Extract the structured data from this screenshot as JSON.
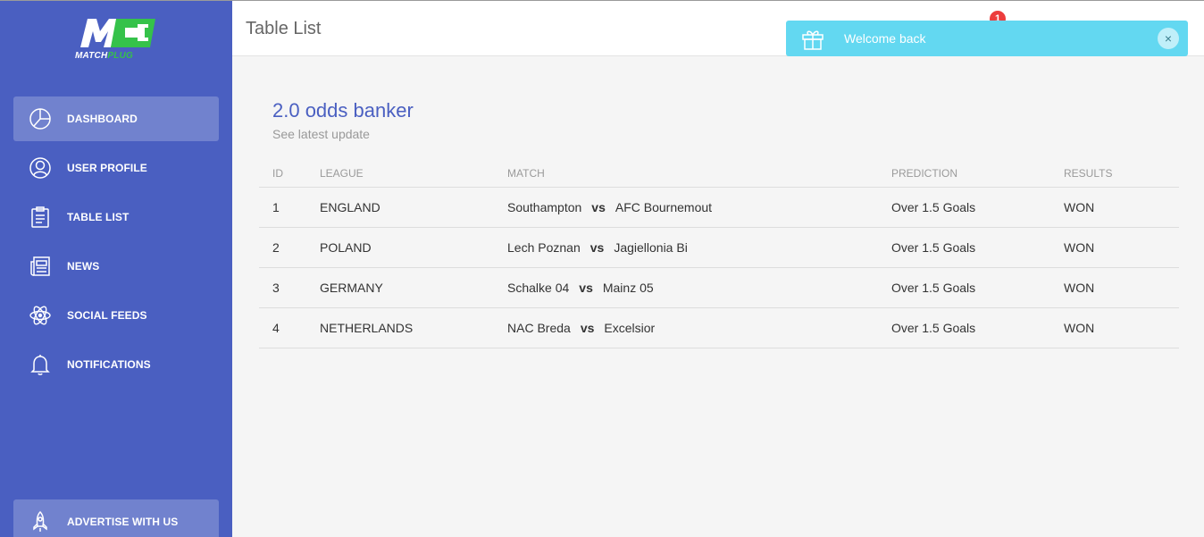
{
  "brand": {
    "mark": "M",
    "name_part1": "MATCH",
    "name_part2": "PLUG"
  },
  "sidebar": {
    "items": [
      {
        "label": "DASHBOARD",
        "icon": "pie-chart-icon",
        "active": true
      },
      {
        "label": "USER PROFILE",
        "icon": "user-icon",
        "active": false
      },
      {
        "label": "TABLE LIST",
        "icon": "clipboard-icon",
        "active": false
      },
      {
        "label": "NEWS",
        "icon": "newspaper-icon",
        "active": false
      },
      {
        "label": "SOCIAL FEEDS",
        "icon": "atom-icon",
        "active": false
      },
      {
        "label": "NOTIFICATIONS",
        "icon": "bell-icon",
        "active": false
      }
    ],
    "footer_item": {
      "label": "ADVERTISE WITH US",
      "icon": "rocket-icon"
    }
  },
  "header": {
    "title": "Table List",
    "notification_count": "1"
  },
  "toast": {
    "message": "Welcome back",
    "icon": "gift-icon",
    "close": "×"
  },
  "card": {
    "title": "2.0 odds banker",
    "subtitle": "See latest update"
  },
  "table": {
    "columns": [
      "ID",
      "LEAGUE",
      "MATCH",
      "PREDICTION",
      "RESULTS"
    ],
    "vs_label": "vs",
    "rows": [
      {
        "id": "1",
        "league": "ENGLAND",
        "home": "Southampton",
        "away": "AFC Bournemout",
        "prediction": "Over 1.5 Goals",
        "result": "WON"
      },
      {
        "id": "2",
        "league": "POLAND",
        "home": "Lech Poznan",
        "away": "Jagiellonia Bi",
        "prediction": "Over 1.5 Goals",
        "result": "WON"
      },
      {
        "id": "3",
        "league": "GERMANY",
        "home": "Schalke 04",
        "away": "Mainz 05",
        "prediction": "Over 1.5 Goals",
        "result": "WON"
      },
      {
        "id": "4",
        "league": "NETHERLANDS",
        "home": "NAC Breda",
        "away": "Excelsior",
        "prediction": "Over 1.5 Goals",
        "result": "WON"
      }
    ]
  },
  "colors": {
    "sidebar": "#4a5fc1",
    "accent": "#4a5fc1",
    "toast": "#63d8f1",
    "badge": "#ec3d3d",
    "brand_green": "#35c24a"
  }
}
